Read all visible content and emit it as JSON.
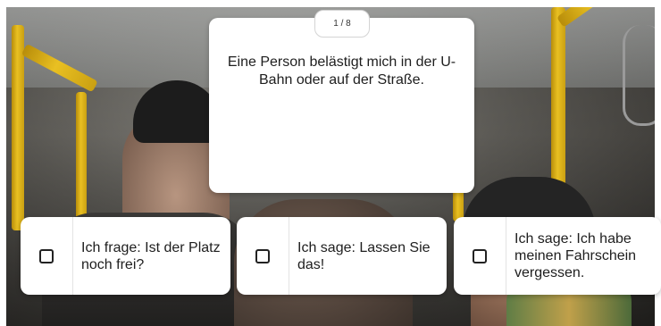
{
  "question": {
    "counter": "1 / 8",
    "text": "Eine Person belästigt mich in der U-Bahn oder auf der Straße."
  },
  "answers": [
    {
      "label": "Ich frage: Ist der Platz noch frei?"
    },
    {
      "label": "Ich sage: Lassen Sie das!"
    },
    {
      "label": "Ich sage: Ich habe meinen Fahrschein vergessen."
    }
  ],
  "icons": {
    "checkbox": "checkbox-icon"
  },
  "colors": {
    "card_background": "#ffffff",
    "text": "#1e1e1e",
    "pole_yellow": "#e9c022"
  }
}
